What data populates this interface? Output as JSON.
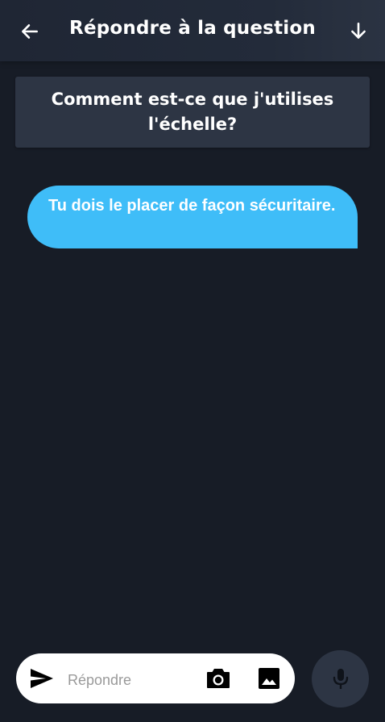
{
  "header": {
    "title": "Répondre à la question",
    "back_icon": "arrow-left-icon",
    "down_icon": "arrow-down-icon"
  },
  "question": {
    "text": "Comment est-ce que j'utilises l'échelle?"
  },
  "messages": [
    {
      "text": "Tu dois le placer de façon sécuritaire.",
      "color": "#3fbdf8"
    }
  ],
  "composer": {
    "placeholder": "Répondre",
    "value": "",
    "send_icon": "send-icon",
    "camera_icon": "camera-icon",
    "image_icon": "image-icon"
  },
  "mic": {
    "icon": "microphone-icon"
  },
  "colors": {
    "background": "#171c26",
    "card": "#2d3544",
    "accent": "#3fbdf8"
  }
}
